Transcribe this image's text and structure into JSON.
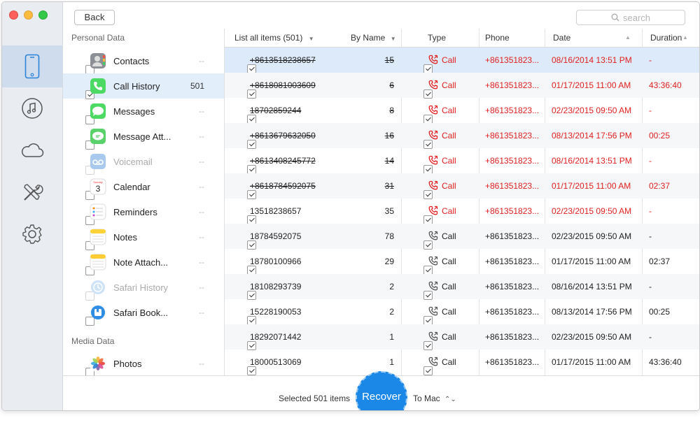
{
  "toolbar": {
    "back_label": "Back",
    "search_placeholder": "search"
  },
  "categories": {
    "personal_title": "Personal Data",
    "media_title": "Media Data",
    "items": [
      {
        "label": "Contacts",
        "count": "--",
        "checked": false,
        "disabled": false,
        "icon": "contacts-icon"
      },
      {
        "label": "Call History",
        "count": "501",
        "checked": true,
        "disabled": false,
        "icon": "phone-app-icon"
      },
      {
        "label": "Messages",
        "count": "--",
        "checked": false,
        "disabled": false,
        "icon": "messages-icon"
      },
      {
        "label": "Message Att...",
        "count": "--",
        "checked": false,
        "disabled": false,
        "icon": "message-attachment-icon"
      },
      {
        "label": "Voicemail",
        "count": "--",
        "checked": false,
        "disabled": true,
        "icon": "voicemail-icon"
      },
      {
        "label": "Calendar",
        "count": "--",
        "checked": false,
        "disabled": false,
        "icon": "calendar-icon"
      },
      {
        "label": "Reminders",
        "count": "--",
        "checked": false,
        "disabled": false,
        "icon": "reminders-icon"
      },
      {
        "label": "Notes",
        "count": "--",
        "checked": false,
        "disabled": false,
        "icon": "notes-icon"
      },
      {
        "label": "Note Attach...",
        "count": "--",
        "checked": false,
        "disabled": false,
        "icon": "note-attachment-icon"
      },
      {
        "label": "Safari History",
        "count": "--",
        "checked": false,
        "disabled": true,
        "icon": "safari-history-icon"
      },
      {
        "label": "Safari Book...",
        "count": "--",
        "checked": false,
        "disabled": false,
        "icon": "safari-bookmarks-icon"
      }
    ],
    "media_items": [
      {
        "label": "Photos",
        "count": "--",
        "checked": false,
        "disabled": false,
        "icon": "photos-icon"
      }
    ],
    "calendar_day": "3",
    "calendar_weekday": "Sunday"
  },
  "table": {
    "list_header": "List all items (501)",
    "sort_header": "By Name",
    "columns": {
      "type": "Type",
      "phone": "Phone",
      "date": "Date",
      "duration": "Duration"
    },
    "rows": [
      {
        "name": "+8613518238657",
        "count": "15",
        "type": "Call",
        "phone": "+861351823...",
        "date": "08/16/2014 13:51 PM",
        "duration": "-",
        "deleted": true
      },
      {
        "name": "+8618081003609",
        "count": "6",
        "type": "Call",
        "phone": "+861351823...",
        "date": "01/17/2015 11:00 AM",
        "duration": "43:36:40",
        "deleted": true
      },
      {
        "name": "18702859244",
        "count": "8",
        "type": "Call",
        "phone": "+861351823...",
        "date": "02/23/2015 09:50 AM",
        "duration": "-",
        "deleted": true
      },
      {
        "name": "+8613679632050",
        "count": "16",
        "type": "Call",
        "phone": "+861351823...",
        "date": "08/13/2014 17:56 PM",
        "duration": "00:25",
        "deleted": true
      },
      {
        "name": "+8613408245772",
        "count": "14",
        "type": "Call",
        "phone": "+861351823...",
        "date": "08/16/2014 13:51 PM",
        "duration": "-",
        "deleted": true
      },
      {
        "name": "+8618784592075",
        "count": "31",
        "type": "Call",
        "phone": "+861351823...",
        "date": "01/17/2015 11:00 AM",
        "duration": "02:37",
        "deleted": true
      },
      {
        "name": "13518238657",
        "count": "35",
        "type": "Call",
        "phone": "+861351823...",
        "date": "02/23/2015 09:50 AM",
        "duration": "-",
        "deleted": false,
        "red": true
      },
      {
        "name": "18784592075",
        "count": "78",
        "type": "Call",
        "phone": "+861351823...",
        "date": "02/23/2015 09:50 AM",
        "duration": "-",
        "deleted": false,
        "red": false
      },
      {
        "name": "18780100966",
        "count": "29",
        "type": "Call",
        "phone": "+861351823...",
        "date": "01/17/2015 11:00 AM",
        "duration": "02:37",
        "deleted": false,
        "red": false
      },
      {
        "name": "18108293739",
        "count": "2",
        "type": "Call",
        "phone": "+861351823...",
        "date": "08/16/2014 13:51 PM",
        "duration": "-",
        "deleted": false,
        "red": false
      },
      {
        "name": "15228190053",
        "count": "2",
        "type": "Call",
        "phone": "+861351823...",
        "date": "08/13/2014 17:56 PM",
        "duration": "00:25",
        "deleted": false,
        "red": false
      },
      {
        "name": "18292071442",
        "count": "1",
        "type": "Call",
        "phone": "+861351823...",
        "date": "02/23/2015 09:50 AM",
        "duration": "-",
        "deleted": false,
        "red": false
      },
      {
        "name": "18000513069",
        "count": "1",
        "type": "Call",
        "phone": "+861351823...",
        "date": "01/17/2015 11:00 AM",
        "duration": "43:36:40",
        "deleted": false,
        "red": false
      }
    ]
  },
  "footer": {
    "selected_text": "Selected 501 items",
    "recover_label": "Recover",
    "destination": "To Mac"
  },
  "colors": {
    "accent": "#1b87e6",
    "deleted_red": "#e02020",
    "selection": "#ddeaf9"
  }
}
